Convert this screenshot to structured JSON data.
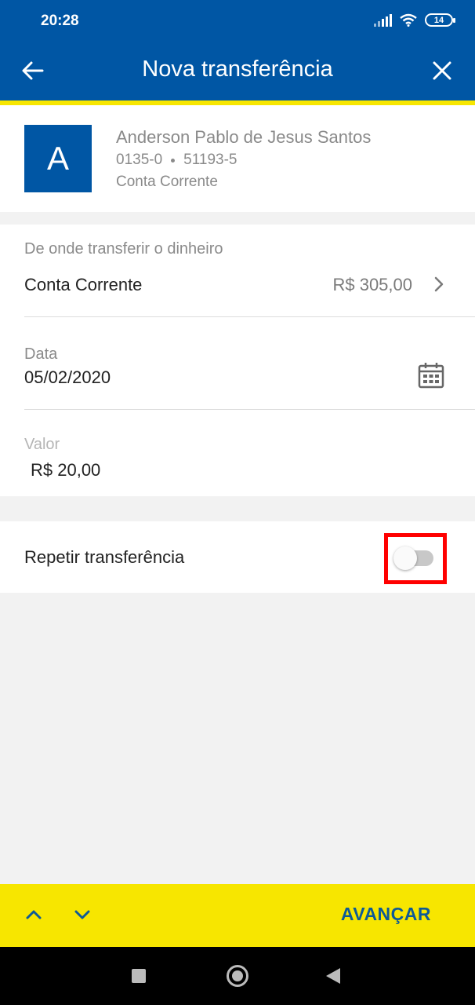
{
  "status_bar": {
    "time": "20:28",
    "battery": "14",
    "icons": [
      "signal-icon",
      "wifi-icon",
      "battery-icon"
    ]
  },
  "header": {
    "title": "Nova transferência",
    "back_icon": "arrow-left-icon",
    "close_icon": "close-icon",
    "color": "#0056a4",
    "accent": "#f7e600"
  },
  "beneficiary": {
    "initial": "A",
    "name": "Anderson Pablo de Jesus Santos",
    "agency": "0135-0",
    "account": "51193-5",
    "account_type": "Conta Corrente"
  },
  "source": {
    "label": "De onde transferir o dinheiro",
    "account": "Conta Corrente",
    "balance": "R$ 305,00"
  },
  "date": {
    "label": "Data",
    "value": "05/02/2020"
  },
  "amount": {
    "label": "Valor",
    "value": "R$ 20,00"
  },
  "repeat": {
    "label": "Repetir transferência",
    "enabled": false
  },
  "actions": {
    "next_label": "AVANÇAR"
  }
}
